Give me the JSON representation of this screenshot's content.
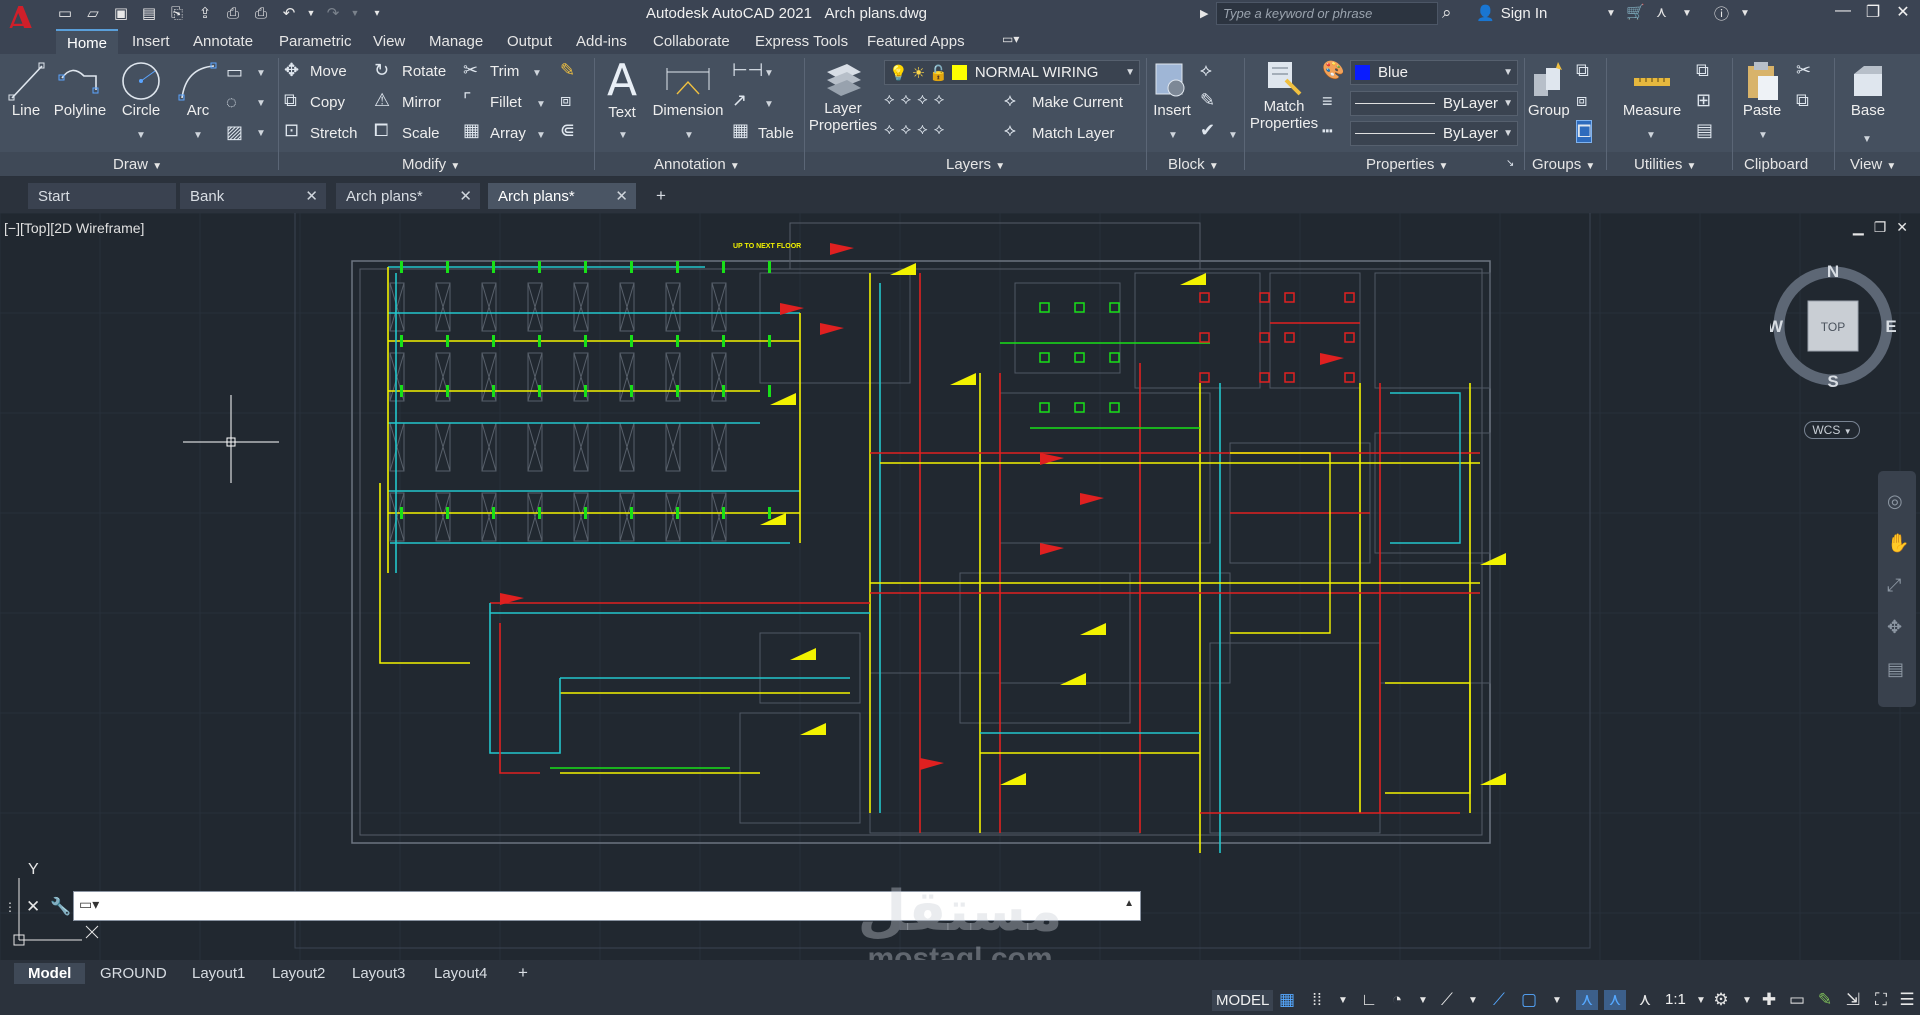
{
  "app": {
    "name": "Autodesk AutoCAD 2021",
    "file": "Arch plans.dwg"
  },
  "search": {
    "placeholder": "Type a keyword or phrase"
  },
  "account": {
    "signin_label": "Sign In"
  },
  "ribbon_tabs": [
    {
      "label": "Home",
      "active": true
    },
    {
      "label": "Insert"
    },
    {
      "label": "Annotate"
    },
    {
      "label": "Parametric"
    },
    {
      "label": "View"
    },
    {
      "label": "Manage"
    },
    {
      "label": "Output"
    },
    {
      "label": "Add-ins"
    },
    {
      "label": "Collaborate"
    },
    {
      "label": "Express Tools"
    },
    {
      "label": "Featured Apps"
    }
  ],
  "ribbon": {
    "draw": {
      "title": "Draw",
      "line": "Line",
      "polyline": "Polyline",
      "circle": "Circle",
      "arc": "Arc"
    },
    "modify": {
      "title": "Modify",
      "move": "Move",
      "rotate": "Rotate",
      "trim": "Trim",
      "copy": "Copy",
      "mirror": "Mirror",
      "fillet": "Fillet",
      "stretch": "Stretch",
      "scale": "Scale",
      "array": "Array"
    },
    "annotation": {
      "title": "Annotation",
      "text": "Text",
      "dimension": "Dimension",
      "table": "Table"
    },
    "layers": {
      "title": "Layers",
      "layer_properties_1": "Layer",
      "layer_properties_2": "Properties",
      "current_layer": "NORMAL WIRING",
      "current_layer_color": "#ffff00",
      "make_current": "Make Current",
      "match_layer": "Match Layer"
    },
    "block": {
      "title": "Block",
      "insert": "Insert"
    },
    "properties": {
      "title": "Properties",
      "match_1": "Match",
      "match_2": "Properties",
      "color": "Blue",
      "color_hex": "#0a1cff",
      "linetype": "ByLayer",
      "lineweight": "ByLayer"
    },
    "groups": {
      "title": "Groups",
      "group": "Group"
    },
    "utilities": {
      "title": "Utilities",
      "measure": "Measure"
    },
    "clipboard": {
      "title": "Clipboard",
      "paste": "Paste"
    },
    "view": {
      "title": "View",
      "base": "Base"
    }
  },
  "doc_tabs": [
    {
      "label": "Start"
    },
    {
      "label": "Bank"
    },
    {
      "label": "Arch plans*"
    },
    {
      "label": "Arch plans*",
      "active": true
    }
  ],
  "viewport": {
    "label": "[−][Top][2D Wireframe]"
  },
  "viewcube": {
    "n": "N",
    "s": "S",
    "e": "E",
    "w": "W",
    "face": "TOP",
    "wcs": "WCS"
  },
  "ucs": {
    "y": "Y"
  },
  "drawing": {
    "note": "UP TO NEXT FLOOR"
  },
  "layout_tabs": [
    {
      "label": "Model",
      "active": true
    },
    {
      "label": "GROUND"
    },
    {
      "label": "Layout1"
    },
    {
      "label": "Layout2"
    },
    {
      "label": "Layout3"
    },
    {
      "label": "Layout4"
    }
  ],
  "status": {
    "space": "MODEL",
    "scale": "1:1"
  },
  "watermark": {
    "arabic": "مستقل",
    "latin": "mostaql.com"
  },
  "colors": {
    "background": "#212830",
    "ribbon": "#45505f",
    "wire_yellow": "#f2f200",
    "wire_green": "#18e018",
    "wire_cyan": "#22c6cc",
    "wire_red": "#e02020"
  }
}
